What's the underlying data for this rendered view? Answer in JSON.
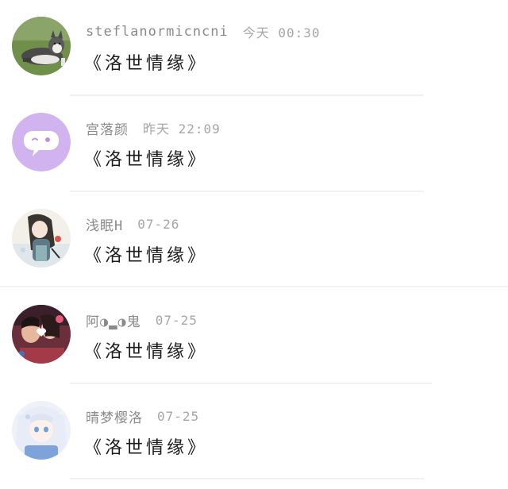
{
  "comments": [
    {
      "username": "steflanormicncni",
      "time": "今天 00:30",
      "text": "《洛世情缘》",
      "avatar": "husky-dog-avatar"
    },
    {
      "username": "宫落颜",
      "time": "昨天 22:09",
      "text": "《洛世情缘》",
      "avatar": "purple-chat-bubble-avatar"
    },
    {
      "username": "浅眠H",
      "time": "07-26",
      "text": "《洛世情缘》",
      "avatar": "anime-girl-avatar"
    },
    {
      "username": "阿◑▂◑鬼",
      "time": "07-25",
      "text": "《洛世情缘》",
      "avatar": "couple-photo-avatar"
    },
    {
      "username": "晴梦樱洛",
      "time": "07-25",
      "text": "《洛世情缘》",
      "avatar": "anime-white-hair-avatar"
    }
  ],
  "colors": {
    "username": "#8a8a8a",
    "time": "#a5a5a5",
    "message": "#1c1c1c",
    "divider": "#f1f1f1",
    "purple_avatar": "#d0b3ef"
  }
}
